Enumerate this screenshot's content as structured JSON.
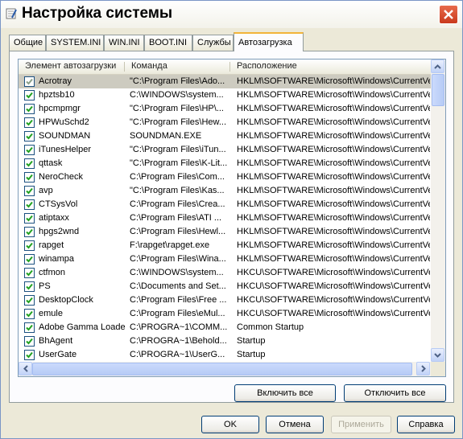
{
  "window": {
    "title": "Настройка системы",
    "close_icon": "close-icon"
  },
  "tabs": [
    {
      "label": "Общие",
      "active": false
    },
    {
      "label": "SYSTEM.INI",
      "active": false
    },
    {
      "label": "WIN.INI",
      "active": false
    },
    {
      "label": "BOOT.INI",
      "active": false
    },
    {
      "label": "Службы",
      "active": false
    },
    {
      "label": "Автозагрузка",
      "active": true
    }
  ],
  "list": {
    "columns": [
      "Элемент автозагрузки",
      "Команда",
      "Расположение"
    ],
    "rows": [
      {
        "checked": true,
        "selected": true,
        "name": "Acrotray",
        "command": "\"C:\\Program Files\\Ado...",
        "location": "HKLM\\SOFTWARE\\Microsoft\\Windows\\CurrentVer..."
      },
      {
        "checked": true,
        "selected": false,
        "name": "hpztsb10",
        "command": "C:\\WINDOWS\\system...",
        "location": "HKLM\\SOFTWARE\\Microsoft\\Windows\\CurrentVer..."
      },
      {
        "checked": true,
        "selected": false,
        "name": "hpcmpmgr",
        "command": "\"C:\\Program Files\\HP\\...",
        "location": "HKLM\\SOFTWARE\\Microsoft\\Windows\\CurrentVer..."
      },
      {
        "checked": true,
        "selected": false,
        "name": "HPWuSchd2",
        "command": "\"C:\\Program Files\\Hew...",
        "location": "HKLM\\SOFTWARE\\Microsoft\\Windows\\CurrentVer..."
      },
      {
        "checked": true,
        "selected": false,
        "name": "SOUNDMAN",
        "command": "SOUNDMAN.EXE",
        "location": "HKLM\\SOFTWARE\\Microsoft\\Windows\\CurrentVer..."
      },
      {
        "checked": true,
        "selected": false,
        "name": "iTunesHelper",
        "command": "\"C:\\Program Files\\iTun...",
        "location": "HKLM\\SOFTWARE\\Microsoft\\Windows\\CurrentVer..."
      },
      {
        "checked": true,
        "selected": false,
        "name": "qttask",
        "command": "\"C:\\Program Files\\K-Lit...",
        "location": "HKLM\\SOFTWARE\\Microsoft\\Windows\\CurrentVer..."
      },
      {
        "checked": true,
        "selected": false,
        "name": "NeroCheck",
        "command": "C:\\Program Files\\Com...",
        "location": "HKLM\\SOFTWARE\\Microsoft\\Windows\\CurrentVer..."
      },
      {
        "checked": true,
        "selected": false,
        "name": "avp",
        "command": "\"C:\\Program Files\\Kas...",
        "location": "HKLM\\SOFTWARE\\Microsoft\\Windows\\CurrentVer..."
      },
      {
        "checked": true,
        "selected": false,
        "name": "CTSysVol",
        "command": "C:\\Program Files\\Crea...",
        "location": "HKLM\\SOFTWARE\\Microsoft\\Windows\\CurrentVer..."
      },
      {
        "checked": true,
        "selected": false,
        "name": "atiptaxx",
        "command": "C:\\Program Files\\ATI ...",
        "location": "HKLM\\SOFTWARE\\Microsoft\\Windows\\CurrentVer..."
      },
      {
        "checked": true,
        "selected": false,
        "name": "hpgs2wnd",
        "command": "C:\\Program Files\\Hewl...",
        "location": "HKLM\\SOFTWARE\\Microsoft\\Windows\\CurrentVer..."
      },
      {
        "checked": true,
        "selected": false,
        "name": "rapget",
        "command": "F:\\rapget\\rapget.exe",
        "location": "HKLM\\SOFTWARE\\Microsoft\\Windows\\CurrentVer..."
      },
      {
        "checked": true,
        "selected": false,
        "name": "winampa",
        "command": "C:\\Program Files\\Wina...",
        "location": "HKLM\\SOFTWARE\\Microsoft\\Windows\\CurrentVer..."
      },
      {
        "checked": true,
        "selected": false,
        "name": "ctfmon",
        "command": "C:\\WINDOWS\\system...",
        "location": "HKCU\\SOFTWARE\\Microsoft\\Windows\\CurrentVer..."
      },
      {
        "checked": true,
        "selected": false,
        "name": "PS",
        "command": "C:\\Documents and Set...",
        "location": "HKCU\\SOFTWARE\\Microsoft\\Windows\\CurrentVer..."
      },
      {
        "checked": true,
        "selected": false,
        "name": "DesktopClock",
        "command": "C:\\Program Files\\Free ...",
        "location": "HKCU\\SOFTWARE\\Microsoft\\Windows\\CurrentVer..."
      },
      {
        "checked": true,
        "selected": false,
        "name": "emule",
        "command": "C:\\Program Files\\eMul...",
        "location": "HKCU\\SOFTWARE\\Microsoft\\Windows\\CurrentVer..."
      },
      {
        "checked": true,
        "selected": false,
        "name": "Adobe Gamma Loader",
        "command": "C:\\PROGRA~1\\COMM...",
        "location": "Common Startup"
      },
      {
        "checked": true,
        "selected": false,
        "name": "BhAgent",
        "command": "C:\\PROGRA~1\\Behold...",
        "location": "Startup"
      },
      {
        "checked": true,
        "selected": false,
        "name": "UserGate",
        "command": "C:\\PROGRA~1\\UserG...",
        "location": "Startup"
      }
    ]
  },
  "actions": {
    "enable_all": "Включить все",
    "disable_all": "Отключить все"
  },
  "footer": {
    "ok": "OK",
    "cancel": "Отмена",
    "apply": "Применить",
    "help": "Справка"
  },
  "colors": {
    "accent_tab": "#f2b43a",
    "check_mark": "#21a121",
    "close_button": "#d44a2a"
  }
}
